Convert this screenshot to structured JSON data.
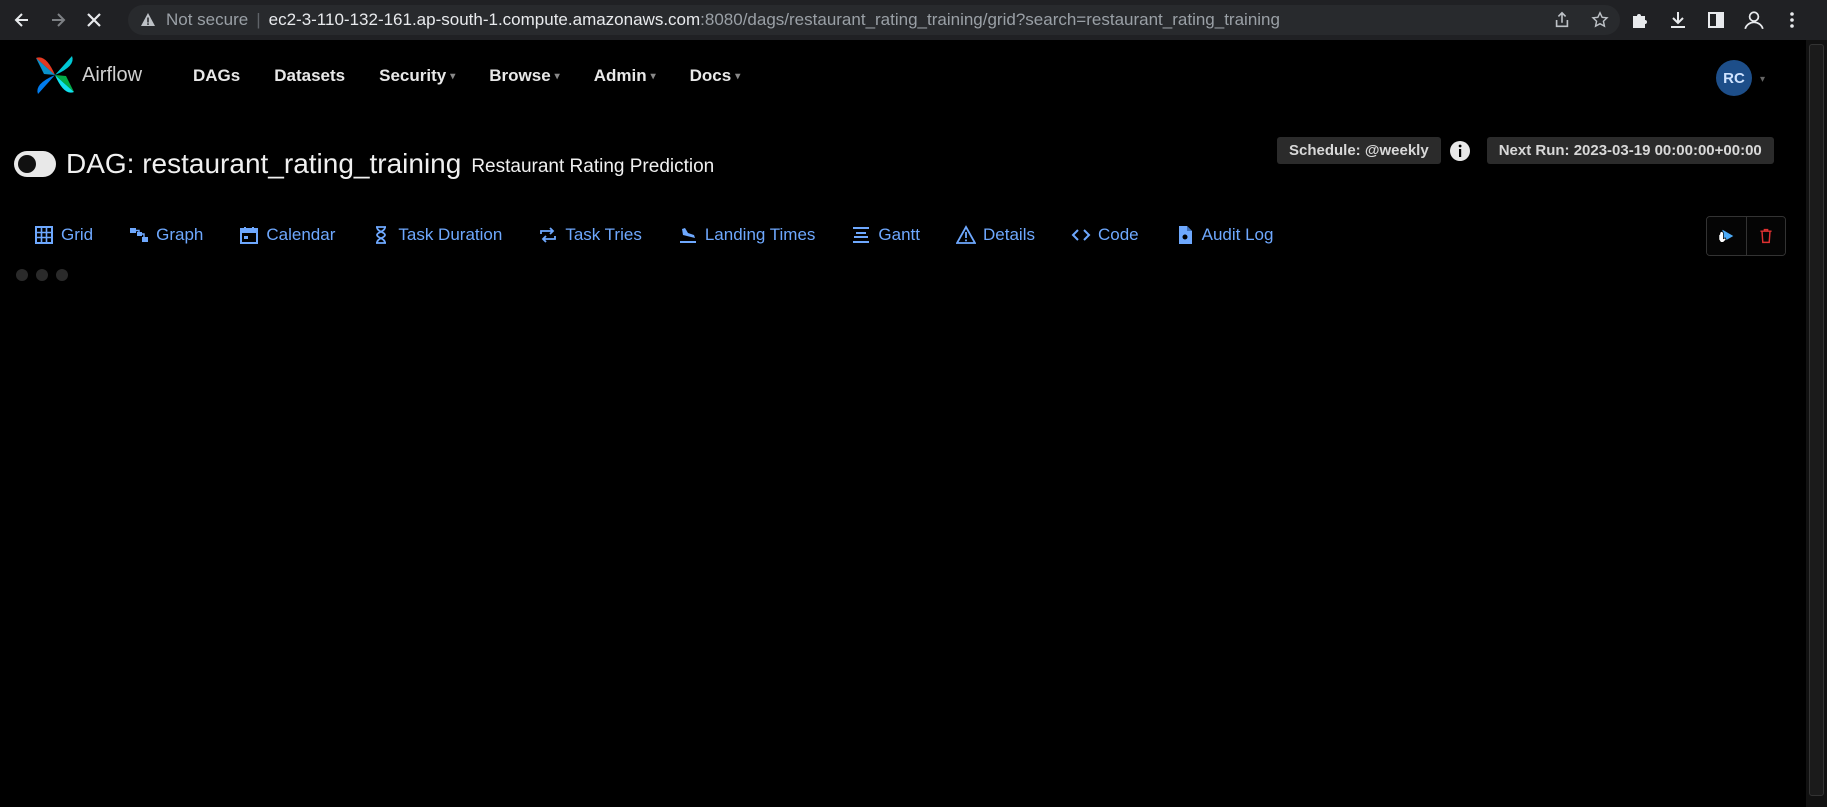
{
  "browser": {
    "not_secure": "Not secure",
    "url_host": "ec2-3-110-132-161.ap-south-1.compute.amazonaws.com",
    "url_rest": ":8080/dags/restaurant_rating_training/grid?search=restaurant_rating_training"
  },
  "navbar": {
    "brand": "Airflow",
    "menu": [
      {
        "label": "DAGs",
        "dropdown": false
      },
      {
        "label": "Datasets",
        "dropdown": false
      },
      {
        "label": "Security",
        "dropdown": true
      },
      {
        "label": "Browse",
        "dropdown": true
      },
      {
        "label": "Admin",
        "dropdown": true
      },
      {
        "label": "Docs",
        "dropdown": true
      }
    ],
    "user_initials": "RC"
  },
  "dag": {
    "title": "DAG: restaurant_rating_training",
    "description": "Restaurant Rating Prediction",
    "schedule": "Schedule: @weekly",
    "next_run": "Next Run: 2023-03-19 00:00:00+00:00"
  },
  "tabs": [
    {
      "label": "Grid",
      "icon": "grid-icon"
    },
    {
      "label": "Graph",
      "icon": "graph-icon"
    },
    {
      "label": "Calendar",
      "icon": "calendar-icon"
    },
    {
      "label": "Task Duration",
      "icon": "hourglass-icon"
    },
    {
      "label": "Task Tries",
      "icon": "retry-icon"
    },
    {
      "label": "Landing Times",
      "icon": "landing-icon"
    },
    {
      "label": "Gantt",
      "icon": "gantt-icon"
    },
    {
      "label": "Details",
      "icon": "warning-icon"
    },
    {
      "label": "Code",
      "icon": "code-icon"
    },
    {
      "label": "Audit Log",
      "icon": "file-icon"
    }
  ],
  "colors": {
    "link": "#6ea8fe",
    "delete": "#e03131",
    "avatar_bg": "#1d4e89"
  }
}
